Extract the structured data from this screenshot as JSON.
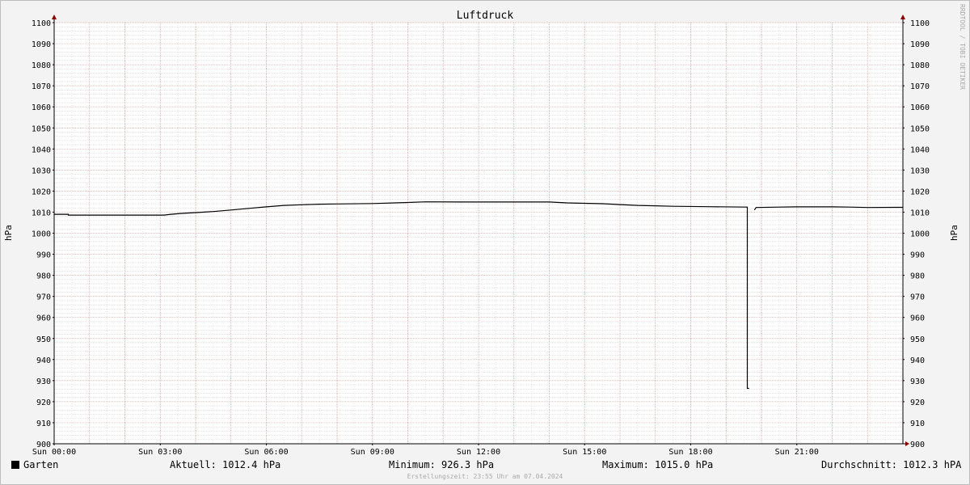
{
  "chart_data": {
    "type": "line",
    "title": "Luftdruck",
    "ylabel_left": "hPa",
    "ylabel_right": "hPa",
    "watermark": "RRDTOOL / TOBI OETIKER",
    "ylim": [
      900,
      1100
    ],
    "y_ticks": [
      900,
      910,
      920,
      930,
      940,
      950,
      960,
      970,
      980,
      990,
      1000,
      1010,
      1020,
      1030,
      1040,
      1050,
      1060,
      1070,
      1080,
      1090,
      1100
    ],
    "xlim_hours": [
      0,
      24
    ],
    "x_ticks": [
      {
        "hour": 0,
        "label": "Sun 00:00"
      },
      {
        "hour": 3,
        "label": "Sun 03:00"
      },
      {
        "hour": 6,
        "label": "Sun 06:00"
      },
      {
        "hour": 9,
        "label": "Sun 09:00"
      },
      {
        "hour": 12,
        "label": "Sun 12:00"
      },
      {
        "hour": 15,
        "label": "Sun 15:00"
      },
      {
        "hour": 18,
        "label": "Sun 18:00"
      },
      {
        "hour": 21,
        "label": "Sun 21:00"
      }
    ],
    "grid": true,
    "series": [
      {
        "name": "Garten",
        "color": "#000000",
        "segments": [
          [
            [
              0.0,
              1009.0
            ],
            [
              0.4,
              1009.0
            ],
            [
              0.4,
              1008.6
            ],
            [
              3.1,
              1008.6
            ],
            [
              3.3,
              1009.0
            ],
            [
              3.6,
              1009.4
            ],
            [
              4.0,
              1009.8
            ],
            [
              4.5,
              1010.3
            ],
            [
              5.0,
              1011.0
            ],
            [
              5.5,
              1011.8
            ],
            [
              6.0,
              1012.5
            ],
            [
              6.5,
              1013.2
            ],
            [
              7.0,
              1013.5
            ],
            [
              7.5,
              1013.8
            ],
            [
              8.0,
              1013.9
            ],
            [
              9.0,
              1014.1
            ],
            [
              10.0,
              1014.6
            ],
            [
              10.5,
              1014.9
            ],
            [
              11.5,
              1014.8
            ],
            [
              14.0,
              1014.8
            ],
            [
              14.5,
              1014.4
            ],
            [
              15.5,
              1014.0
            ],
            [
              16.0,
              1013.6
            ],
            [
              16.5,
              1013.2
            ],
            [
              17.0,
              1013.0
            ],
            [
              17.5,
              1012.8
            ],
            [
              18.5,
              1012.6
            ],
            [
              19.6,
              1012.4
            ],
            [
              19.6,
              926.3
            ],
            [
              19.65,
              926.3
            ]
          ],
          [
            [
              19.8,
              1011.0
            ],
            [
              19.85,
              1012.2
            ],
            [
              20.5,
              1012.4
            ],
            [
              21.0,
              1012.5
            ],
            [
              22.0,
              1012.5
            ],
            [
              22.5,
              1012.4
            ],
            [
              23.0,
              1012.2
            ],
            [
              23.8,
              1012.3
            ],
            [
              24.0,
              1012.3
            ]
          ]
        ]
      }
    ]
  },
  "legend": {
    "series_name": "Garten",
    "aktuell": "Aktuell: 1012.4 hPa",
    "minimum": "Minimum: 926.3 hPa",
    "maximum": "Maximum: 1015.0 hPa",
    "durchschnitt": "Durchschnitt: 1012.3 hPA"
  },
  "footer": "Erstellungszeit: 23:55 Uhr am 07.04.2024",
  "colors": {
    "background": "#f3f3f3",
    "plot_background": "#ffffff",
    "major_grid": "#e0a0a0",
    "minor_grid": "#cfcfcf",
    "axis": "#000000",
    "arrow": "#880000",
    "line": "#000000"
  }
}
